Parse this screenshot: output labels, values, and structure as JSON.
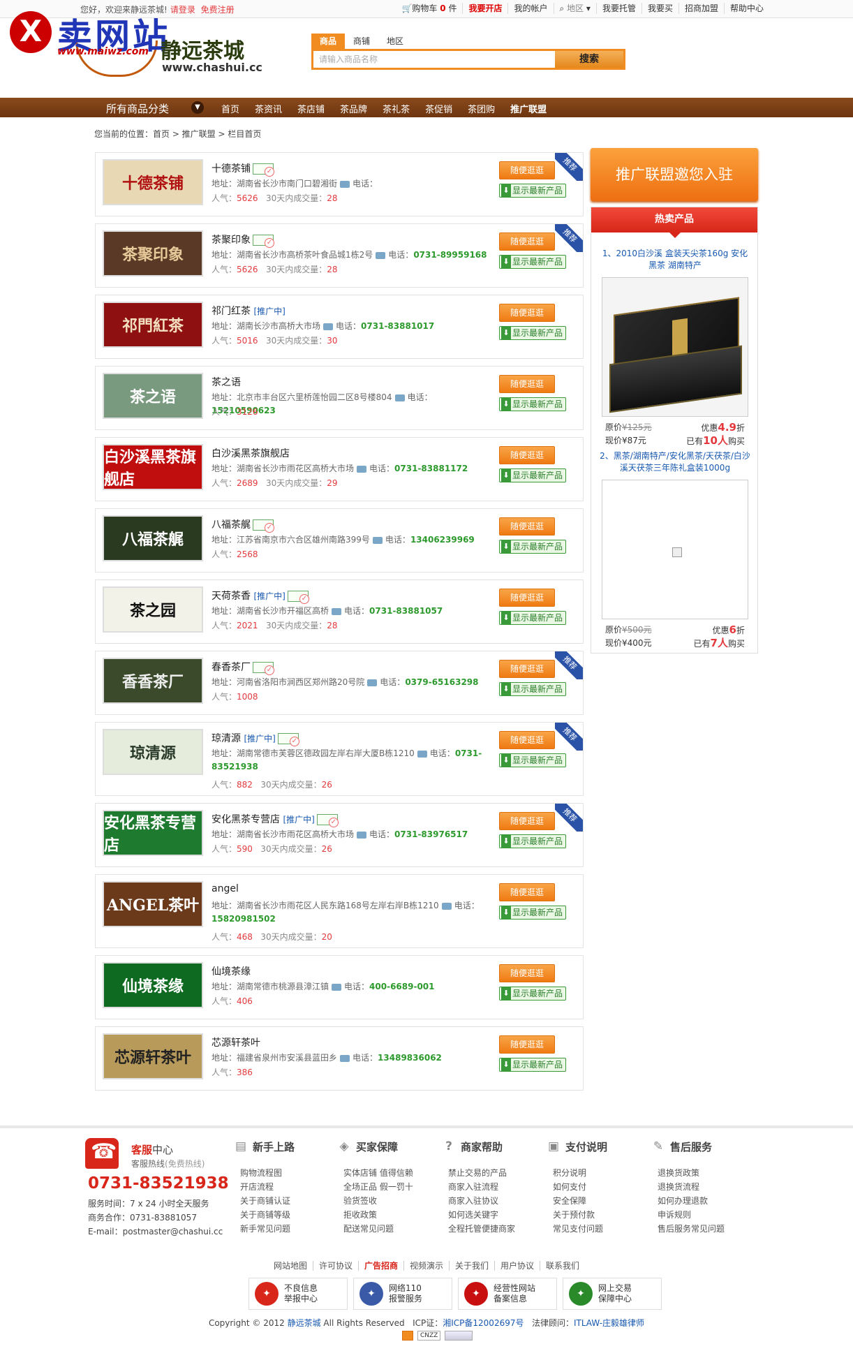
{
  "topbar": {
    "welcome": "您好，欢迎来静远茶城!",
    "login": "请登录",
    "register": "免费注册",
    "cart": "购物车",
    "cart_count": "0",
    "cart_unit": "件",
    "open_shop": "我要开店",
    "my_account": "我的帐户",
    "region": "地区",
    "host": "我要托管",
    "buy": "我要买",
    "join": "招商加盟",
    "help": "帮助中心"
  },
  "watermark": {
    "text": "卖网站",
    "url": "www.maiwz.com",
    "x": "X"
  },
  "logo": {
    "cn": "静远茶城",
    "en": "www.chashui.cc"
  },
  "search": {
    "tabs": [
      "商品",
      "商铺",
      "地区"
    ],
    "placeholder": "请输入商品名称",
    "button": "搜索"
  },
  "nav": {
    "all": "所有商品分类",
    "items": [
      "首页",
      "茶资讯",
      "茶店铺",
      "茶品牌",
      "茶礼茶",
      "茶促销",
      "茶团购",
      "推广联盟"
    ]
  },
  "crumb": "您当前的位置：首页 > 推广联盟 > 栏目首页",
  "labels": {
    "addr": "地址：",
    "tel": "电话：",
    "pop": "人气：",
    "deal": "30天内成交量：",
    "visit": "随便逛逛",
    "newest": "显示最新产品",
    "rec": "推荐",
    "promo": "[推广中]"
  },
  "stores": [
    {
      "name": "十德茶铺",
      "promo": false,
      "addr": "湖南省长沙市南门口碧湘街",
      "tel": "",
      "pop": "5626",
      "deal": "28",
      "rec": true,
      "logo": "十德茶铺",
      "bg": "#e9d8b4",
      "fg": "#b01010"
    },
    {
      "name": "茶聚印象",
      "promo": false,
      "addr": "湖南省长沙市高桥茶叶食品城1栋2号",
      "tel": "0731-89959168",
      "pop": "5626",
      "deal": "28",
      "rec": true,
      "logo": "茶聚印象",
      "bg": "#5a3a26",
      "fg": "#e8c99a"
    },
    {
      "name": "祁门红茶",
      "promo": true,
      "addr": "湖南长沙市高桥大市场",
      "tel": "0731-83881017",
      "pop": "5016",
      "deal": "30",
      "rec": false,
      "logo": "祁門紅茶",
      "bg": "#8e1010",
      "fg": "#f3e0c0"
    },
    {
      "name": "茶之语",
      "promo": false,
      "addr": "北京市丰台区六里桥莲怡园二区8号楼804",
      "tel": "15210590623",
      "pop": "3126",
      "deal": "",
      "rec": false,
      "logo": "茶之语",
      "bg": "#7a9a80",
      "fg": "#fff"
    },
    {
      "name": "白沙溪黑茶旗舰店",
      "promo": false,
      "addr": "湖南省长沙市雨花区高桥大市场",
      "tel": "0731-83881172",
      "pop": "2689",
      "deal": "29",
      "rec": false,
      "logo": "白沙溪黑茶旗舰店",
      "bg": "#c00d0d",
      "fg": "#fff"
    },
    {
      "name": "八福茶艉",
      "promo": false,
      "addr": "江苏省南京市六合区雄州南路399号",
      "tel": "13406239969",
      "pop": "2568",
      "deal": "",
      "rec": false,
      "logo": "八福茶艉",
      "bg": "#2a3a20",
      "fg": "#fff"
    },
    {
      "name": "天荷茶香",
      "promo": true,
      "addr": "湖南省长沙市开福区高桥",
      "tel": "0731-83881057",
      "pop": "2021",
      "deal": "28",
      "rec": false,
      "logo": "茶之园",
      "bg": "#f2f2e8",
      "fg": "#111"
    },
    {
      "name": "春香茶厂",
      "promo": false,
      "addr": "河南省洛阳市涧西区郑州路20号院",
      "tel": "0379-65163298",
      "pop": "1008",
      "deal": "",
      "rec": true,
      "logo": "香香茶厂",
      "bg": "#3a4a2a",
      "fg": "#eee"
    },
    {
      "name": "琼清源",
      "promo": true,
      "addr": "湖南常德市芙蓉区德政园左岸右岸大厦B栋1210",
      "tel": "0731-83521938",
      "pop": "882",
      "deal": "26",
      "rec": true,
      "logo": "琼清源",
      "bg": "#e6ecdc",
      "fg": "#2a3a2a"
    },
    {
      "name": "安化黑茶专营店",
      "promo": true,
      "addr": "湖南省长沙市雨花区高桥大市场",
      "tel": "0731-83976517",
      "pop": "590",
      "deal": "26",
      "rec": true,
      "logo": "安化黑茶专营店",
      "bg": "#1e7a2e",
      "fg": "#fff"
    },
    {
      "name": "angel",
      "promo": false,
      "addr": "湖南省长沙市雨花区人民东路168号左岸右岸B栋1210",
      "tel": "15820981502",
      "pop": "468",
      "deal": "20",
      "rec": false,
      "logo": "ANGEL茶叶",
      "bg": "#6a3a1a",
      "fg": "#fff"
    },
    {
      "name": "仙境茶缘",
      "promo": false,
      "addr": "湖南常德市桃源县漳江镇",
      "tel": "400-6689-001",
      "pop": "406",
      "deal": "",
      "rec": false,
      "logo": "仙境茶缘",
      "bg": "#0d6a20",
      "fg": "#fff"
    },
    {
      "name": "芯源轩茶叶",
      "promo": false,
      "addr": "福建省泉州市安溪县蓝田乡",
      "tel": "13489836062",
      "pop": "386",
      "deal": "",
      "rec": false,
      "logo": "芯源轩茶叶",
      "bg": "#b89a5a",
      "fg": "#222"
    }
  ],
  "sidebar": {
    "banner": "推广联盟邀您入驻",
    "hot_title": "热卖产品",
    "products": [
      {
        "title": "1、2010白沙溪 盒装天尖茶160g 安化黑茶 湖南特产",
        "orig_label": "原价",
        "orig": "¥125元",
        "disc_label": "优惠",
        "disc": "4.9",
        "disc_unit": "折",
        "now_label": "现价",
        "now": "¥87元",
        "sold_label": "已有",
        "sold": "10人",
        "sold_unit": "购买"
      },
      {
        "title": "2、黑茶/湖南特产/安化黑茶/天茯茶/白沙溪天茯茶三年陈礼盒装1000g",
        "orig_label": "原价",
        "orig": "¥500元",
        "disc_label": "优惠",
        "disc": "6",
        "disc_unit": "折",
        "now_label": "现价",
        "now": "¥400元",
        "sold_label": "已有",
        "sold": "7人",
        "sold_unit": "购买"
      }
    ]
  },
  "footer": {
    "service_title": "客服",
    "service_title2": "中心",
    "hotline_label": "客服热线",
    "hotline_free": "(免费热线)",
    "hotline": "0731-83521938",
    "info": [
      "服务时间：7 x 24 小时全天服务",
      "商务合作：0731-83881057",
      "E-mail：postmaster@chashui.cc"
    ],
    "cols": [
      {
        "title": "新手上路",
        "icon": "▤",
        "items": [
          "购物流程图",
          "开店流程",
          "关于商铺认证",
          "关于商铺等级",
          "新手常见问题"
        ]
      },
      {
        "title": "买家保障",
        "icon": "◈",
        "items": [
          "实体店铺 值得信赖",
          "全场正品 假一罚十",
          "验货签收",
          "拒收政策",
          "配送常见问题"
        ]
      },
      {
        "title": "商家帮助",
        "icon": "?",
        "items": [
          "禁止交易的产品",
          "商家入驻流程",
          "商家入驻协议",
          "如何选关键字",
          "全程托管便捷商家"
        ]
      },
      {
        "title": "支付说明",
        "icon": "▣",
        "items": [
          "积分说明",
          "如何支付",
          "安全保障",
          "关于预付款",
          "常见支付问题"
        ]
      },
      {
        "title": "售后服务",
        "icon": "✎",
        "items": [
          "退换货政策",
          "退换货流程",
          "如何办理退款",
          "申诉规则",
          "售后服务常见问题"
        ]
      }
    ],
    "links": [
      "网站地图",
      "许可协议",
      "广告招商",
      "视频演示",
      "关于我们",
      "用户协议",
      "联系我们"
    ],
    "badges": [
      {
        "t1": "不良信息",
        "t2": "举报中心",
        "color": "#d8261a"
      },
      {
        "t1": "网络110",
        "t2": "报警服务",
        "color": "#3a5aa8"
      },
      {
        "t1": "经营性网站",
        "t2": "备案信息",
        "color": "#c81010"
      },
      {
        "t1": "网上交易",
        "t2": "保障中心",
        "color": "#2a8a2a"
      }
    ],
    "copyright": "Copyright © 2012",
    "site": "静远茶城",
    "rights": "All Rights Reserved",
    "icp_label": "ICP证：",
    "icp": "湘ICP备12002697号",
    "law_label": "法律顾问：",
    "law": "ITLAW-庄毅雄律师",
    "cnzz": "CNZZ"
  }
}
